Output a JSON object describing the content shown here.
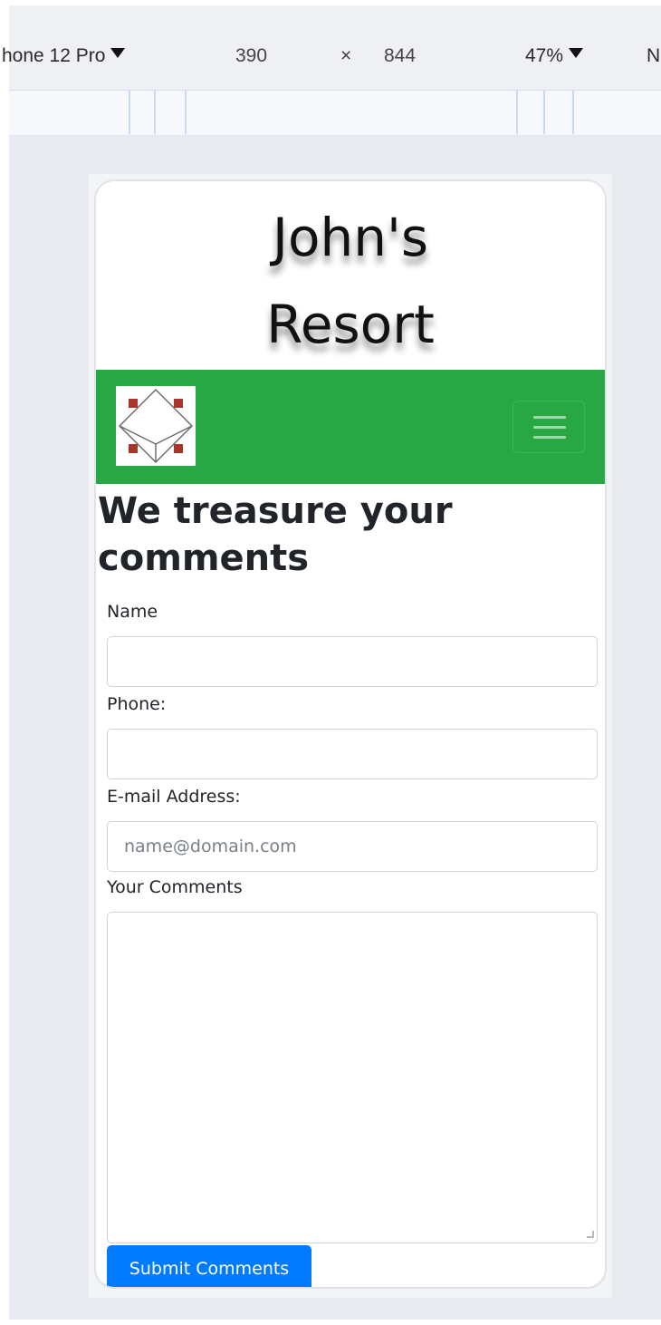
{
  "devtools": {
    "device": "hone 12 Pro",
    "width": "390",
    "times": "×",
    "height": "844",
    "zoom": "47%",
    "next_cut": "N"
  },
  "site": {
    "title_line1": "John's",
    "title_line2": "Resort"
  },
  "navbar": {
    "color": "#28a745",
    "logo_icon": "cube-logo-icon",
    "toggler_icon": "hamburger-menu-icon"
  },
  "form": {
    "heading": "We treasure your comments",
    "name_label": "Name",
    "name_value": "",
    "phone_label": "Phone:",
    "phone_value": "",
    "email_label": "E-mail Address:",
    "email_placeholder": "name@domain.com",
    "comments_label": "Your Comments",
    "comments_value": "",
    "submit_label": "Submit Comments",
    "submit_color": "#007bff"
  }
}
